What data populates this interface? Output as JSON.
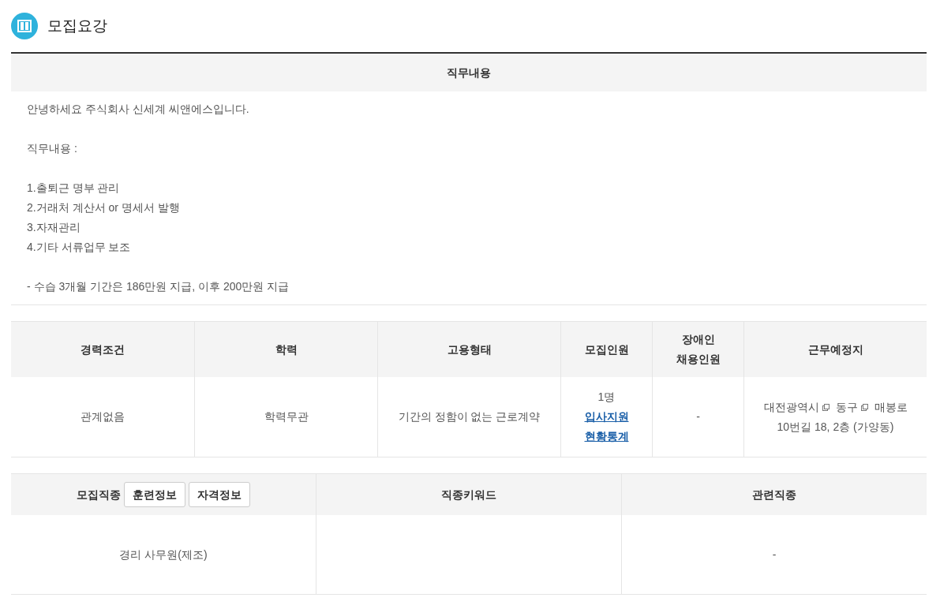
{
  "section_title": "모집요강",
  "job_description": {
    "heading": "직무내용",
    "paragraphs": [
      [
        "안녕하세요 주식회사 신세계 씨앤에스입니다."
      ],
      [
        "직무내용 :"
      ],
      [
        "1.출퇴근 명부 관리",
        "2.거래처 계산서 or 명세서 발행",
        "3.자재관리",
        "4.기타 서류업무 보조"
      ],
      [
        "- 수습 3개월 기간은 186만원 지급, 이후 200만원 지급"
      ]
    ]
  },
  "conditions_table": {
    "columns": [
      [
        "경력조건"
      ],
      [
        "학력"
      ],
      [
        "고용형태"
      ],
      [
        "모집인원"
      ],
      [
        "장애인",
        "채용인원"
      ],
      [
        "근무예정지"
      ]
    ],
    "row": {
      "experience": "관계없음",
      "education": "학력무관",
      "employment_type": "기간의 정함이 없는 근로계약",
      "headcount": "1명",
      "stats_link": "입사지원 현황통계",
      "disabled_hires": "-",
      "location": [
        {
          "text": "대전광역시",
          "popup": true
        },
        {
          "text": "동구",
          "popup": true
        },
        {
          "text": "매봉로",
          "popup": false
        },
        {
          "text": "10번길 18, 2층 (가양동)",
          "popup": false
        }
      ]
    }
  },
  "occupation_table": {
    "columns": [
      {
        "label": "모집직종",
        "buttons": [
          "훈련정보",
          "자격정보"
        ],
        "cell": "경리 사무원(제조)"
      },
      {
        "label": "직종키워드"
      },
      {
        "label": "관련직종",
        "cell": "-"
      }
    ]
  }
}
